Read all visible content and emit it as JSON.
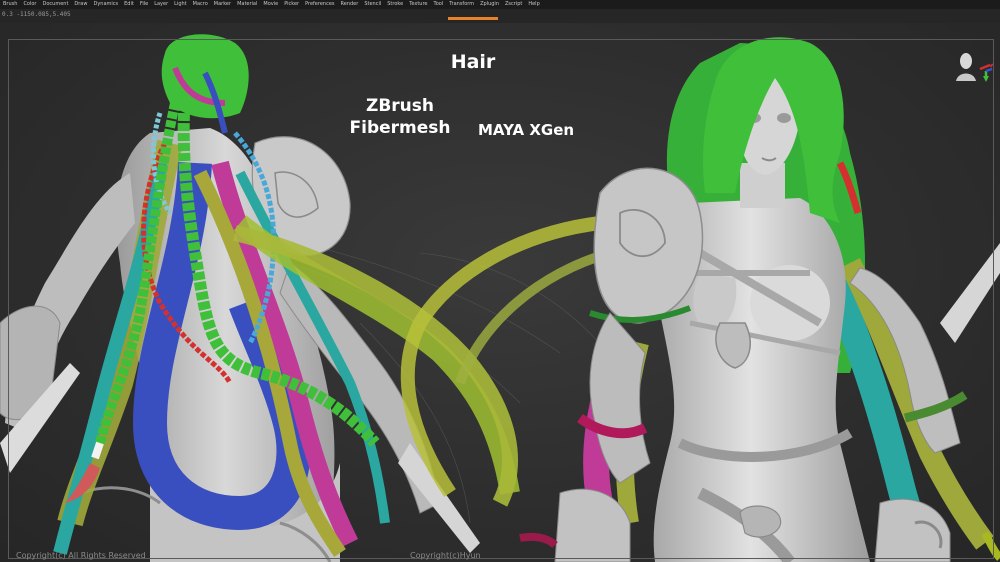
{
  "menu": {
    "items": [
      "Brush",
      "Color",
      "Document",
      "Draw",
      "Dynamics",
      "Edit",
      "File",
      "Layer",
      "Light",
      "Macro",
      "Marker",
      "Material",
      "Movie",
      "Picker",
      "Preferences",
      "Render",
      "Stencil",
      "Stroke",
      "Texture",
      "Tool",
      "Transform",
      "Zplugin",
      "Zscript",
      "Help"
    ]
  },
  "infobar": {
    "coords": "0.3 -1150.085,5.405"
  },
  "overlay": {
    "title": "Hair",
    "zbrush_line1": "ZBrush",
    "zbrush_line2": "Fibermesh",
    "maya": "MAYA XGen"
  },
  "footer": {
    "copyright_left": "Copyright(c) All Rights Reserved",
    "copyright_center": "Copyright(c)Hyun"
  },
  "colors": {
    "accent": "#e8822a",
    "skin": "#cfcfcf",
    "hair_green": "#3fbf3a",
    "hair_blue": "#3a4fbf",
    "hair_magenta": "#c03a98",
    "hair_red": "#d43030",
    "hair_teal": "#2aa7a0",
    "hair_olive": "#9fa83a",
    "hair_cyan": "#4aa8d8"
  }
}
